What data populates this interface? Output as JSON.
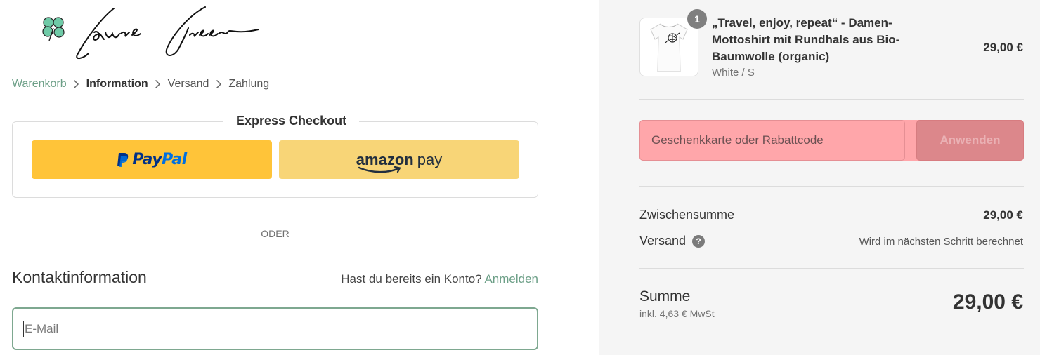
{
  "logo": {
    "brand": "Laure Green",
    "clover_color": "#6fcaa7"
  },
  "breadcrumb": {
    "items": [
      {
        "label": "Warenkorb",
        "state": "link"
      },
      {
        "label": "Information",
        "state": "current"
      },
      {
        "label": "Versand",
        "state": "upcoming"
      },
      {
        "label": "Zahlung",
        "state": "upcoming"
      }
    ]
  },
  "express": {
    "title": "Express Checkout",
    "paypal": {
      "word_pay": "Pay",
      "word_pal": "Pal",
      "color": "#ffc439"
    },
    "amazon": {
      "word_amazon": "amazon",
      "word_pay": "pay",
      "color": "#f8d577"
    }
  },
  "divider_or": "ODER",
  "contact": {
    "title": "Kontaktinformation",
    "account_question": "Hast du bereits ein Konto?",
    "login_link": "Anmelden",
    "email_placeholder": "E-Mail"
  },
  "summary": {
    "product": {
      "quantity": "1",
      "name": "„Travel, enjoy, repeat“ - Damen-Mottoshirt mit Rundhals aus Bio-Baumwolle (organic)",
      "variant": "White / S",
      "price": "29,00 €"
    },
    "discount": {
      "placeholder": "Geschenkkarte oder Rabattcode",
      "apply_label": "Anwenden"
    },
    "subtotal": {
      "label": "Zwischensumme",
      "value": "29,00 €"
    },
    "shipping": {
      "label": "Versand",
      "help": "?",
      "value": "Wird im nächsten Schritt berechnet"
    },
    "total": {
      "label": "Summe",
      "tax_note": "inkl. 4,63 € MwSt",
      "value": "29,00 €"
    }
  },
  "colors": {
    "accent": "#6c9f87",
    "highlight": "#ffa6aa"
  }
}
